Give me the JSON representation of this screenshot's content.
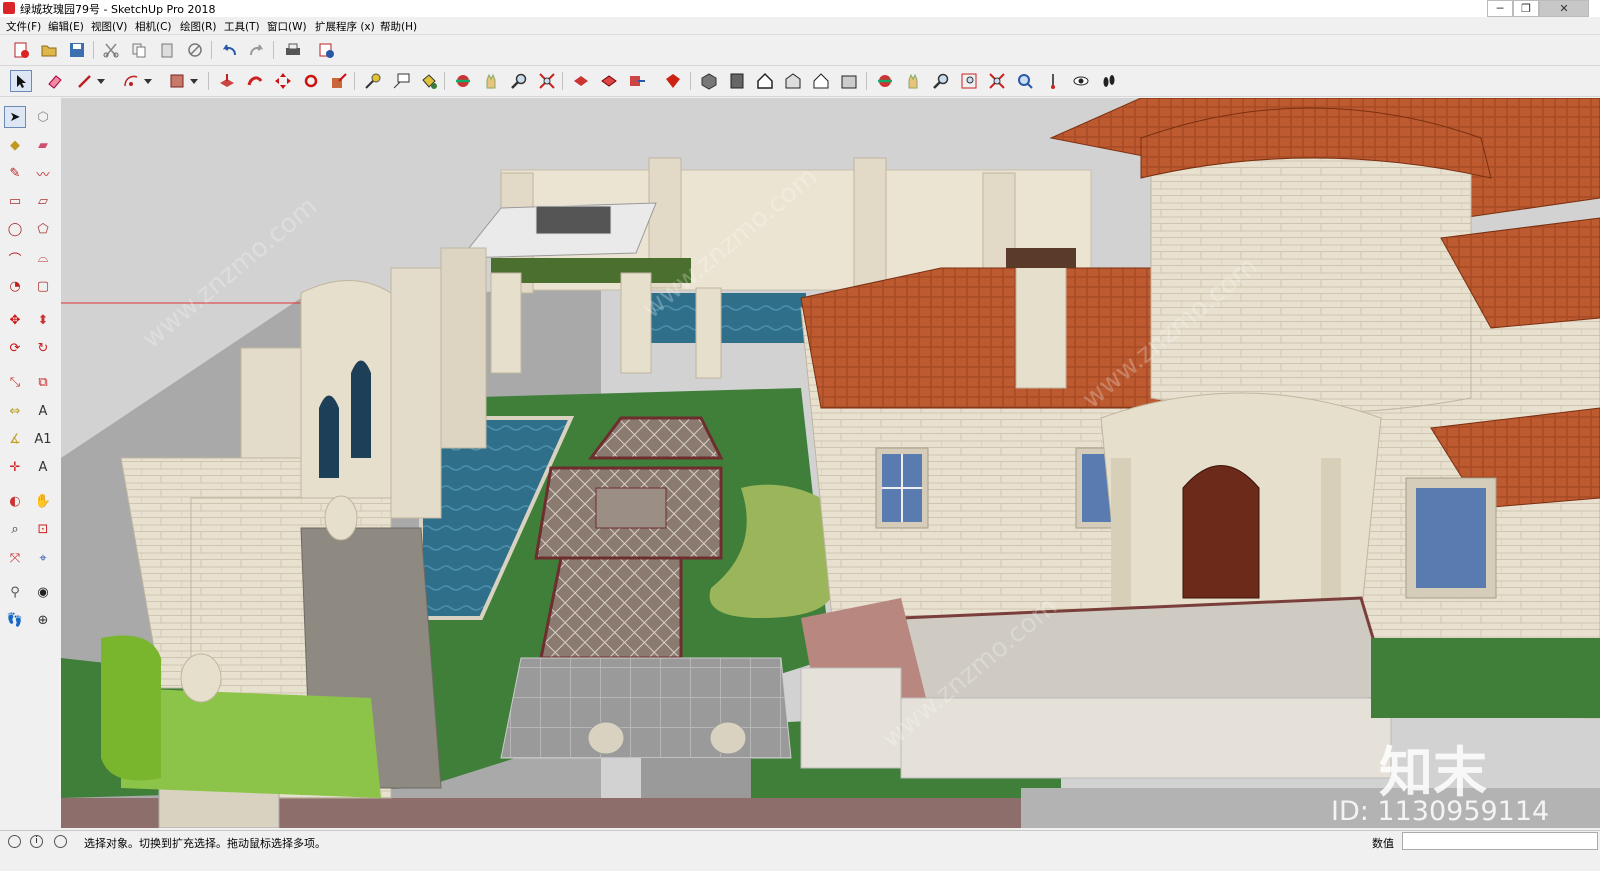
{
  "window": {
    "title": "绿城玫瑰园79号 - SketchUp Pro 2018",
    "controls": [
      "─",
      "❐",
      "✕"
    ]
  },
  "menubar": {
    "items": [
      "文件(F)",
      "编辑(E)",
      "视图(V)",
      "相机(C)",
      "绘图(R)",
      "工具(T)",
      "窗口(W)",
      "扩展程序 (x)",
      "帮助(H)"
    ]
  },
  "toolbar_top": [
    "new",
    "open",
    "save",
    "cut",
    "copy",
    "paste",
    "erase",
    "undo",
    "redo",
    "print",
    "model-info"
  ],
  "toolbar_main": [
    "select",
    "eraser",
    "line",
    "arc",
    "rectangle",
    "push-pull",
    "follow-me",
    "move",
    "rotate",
    "scale",
    "tape-measure",
    "text",
    "paint-bucket",
    "orbit",
    "pan",
    "zoom",
    "zoom-extents",
    "previous",
    "next",
    "3d-warehouse",
    "iso",
    "top",
    "front",
    "right",
    "back",
    "left",
    "walk",
    "look-around",
    "position-camera"
  ],
  "left_toolbar": [
    "select",
    "make-component",
    "paint-bucket",
    "eraser",
    "line",
    "freehand",
    "rectangle",
    "rotated-rectangle",
    "circle",
    "polygon",
    "arc",
    "two-point-arc",
    "pie",
    "offset",
    "move",
    "push-pull",
    "rotate",
    "follow-me",
    "scale",
    "offset2",
    "tape-measure",
    "dimension",
    "protractor",
    "text",
    "axes",
    "3d-text",
    "orbit",
    "pan",
    "zoom",
    "zoom-window",
    "zoom-extents",
    "previous",
    "position-camera",
    "look-around",
    "walk",
    "section-plane"
  ],
  "watermarks": {
    "brand": "知末",
    "id": "ID: 1130959114",
    "diagonal": "www.znzmo.com"
  },
  "status": {
    "message": "选择对象。切换到扩充选择。拖动鼠标选择多项。",
    "value_label": "数值",
    "value": ""
  },
  "colors": {
    "roof": "#b9552e",
    "wall": "#e8e0cf",
    "lawn": "#3f7f3a",
    "pool": "#2f6f8a",
    "sky": "#d4d4d4"
  }
}
